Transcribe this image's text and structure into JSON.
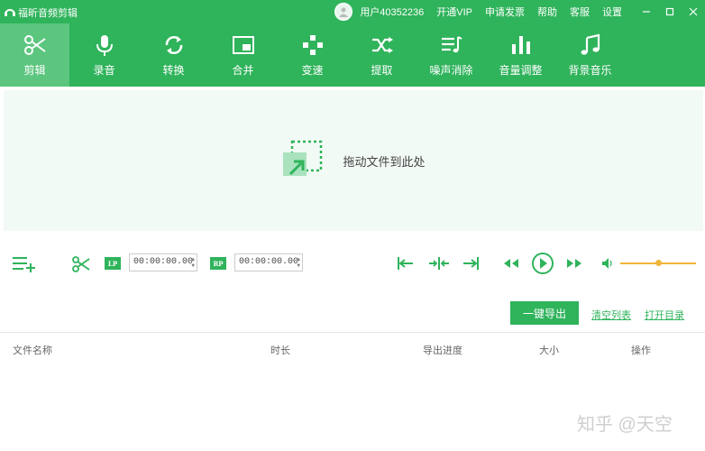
{
  "window": {
    "title": "福昕音频剪辑",
    "user": "用户40352236",
    "links": [
      "开通VIP",
      "申请发票",
      "帮助",
      "客服",
      "设置"
    ]
  },
  "toolbar": {
    "items": [
      {
        "label": "剪辑",
        "icon": "scissors-icon"
      },
      {
        "label": "录音",
        "icon": "microphone-icon"
      },
      {
        "label": "转换",
        "icon": "convert-icon"
      },
      {
        "label": "合并",
        "icon": "merge-icon"
      },
      {
        "label": "变速",
        "icon": "speed-icon"
      },
      {
        "label": "提取",
        "icon": "extract-icon"
      },
      {
        "label": "噪声消除",
        "icon": "noise-icon"
      },
      {
        "label": "音量调整",
        "icon": "volume-bars-icon"
      },
      {
        "label": "背景音乐",
        "icon": "music-note-icon"
      }
    ]
  },
  "drop": {
    "text": "拖动文件到此处"
  },
  "controls": {
    "lp_label": "LP",
    "rp_label": "RP",
    "start_time": "00:00:00.00",
    "end_time": "00:00:00.00",
    "volume_level": 0.5
  },
  "actions": {
    "export": "一键导出",
    "clear": "清空列表",
    "open_dir": "打开目录"
  },
  "table": {
    "columns": [
      "文件名称",
      "时长",
      "导出进度",
      "大小",
      "操作"
    ]
  },
  "watermark": "知乎 @天空",
  "colors": {
    "primary": "#2fb35b",
    "active": "#5cc67f",
    "volume": "#f1b53a"
  }
}
